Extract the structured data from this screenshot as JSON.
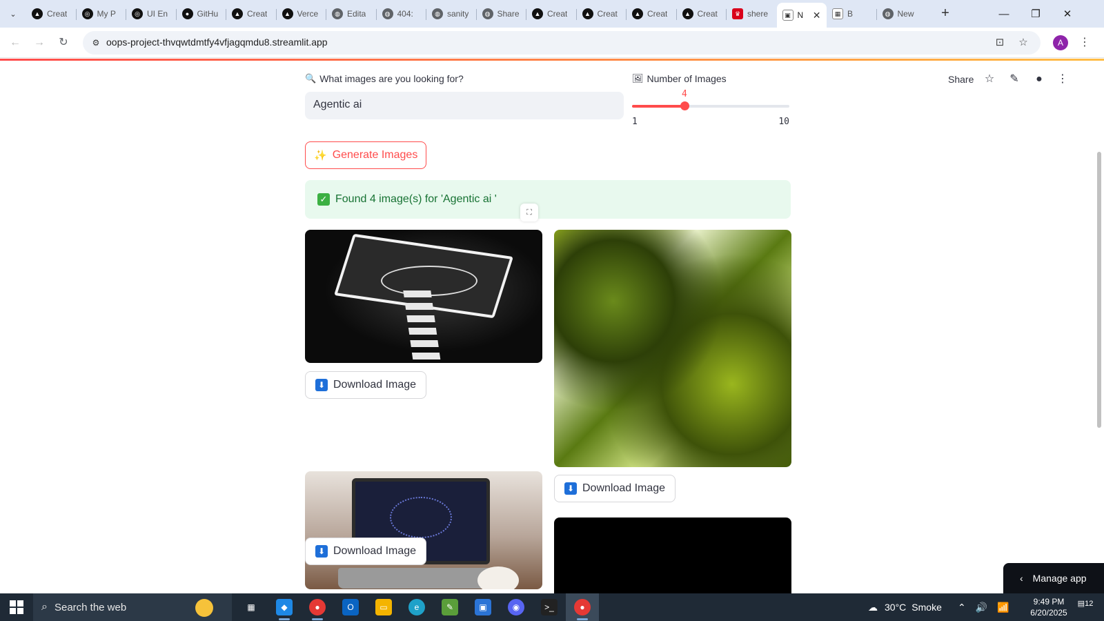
{
  "browser": {
    "tabs": [
      {
        "label": "Creat",
        "favicon": "triangle-logo"
      },
      {
        "label": "My P",
        "favicon": "openai-logo"
      },
      {
        "label": "UI En",
        "favicon": "openai-logo"
      },
      {
        "label": "GitHu",
        "favicon": "github-logo"
      },
      {
        "label": "Creat",
        "favicon": "triangle-logo"
      },
      {
        "label": "Verce",
        "favicon": "triangle-logo"
      },
      {
        "label": "Edita",
        "favicon": "globe"
      },
      {
        "label": "404:",
        "favicon": "globe"
      },
      {
        "label": "sanity",
        "favicon": "globe"
      },
      {
        "label": "Share",
        "favicon": "globe"
      },
      {
        "label": "Creat",
        "favicon": "triangle-logo"
      },
      {
        "label": "Creat",
        "favicon": "triangle-logo"
      },
      {
        "label": "Creat",
        "favicon": "triangle-logo"
      },
      {
        "label": "Creat",
        "favicon": "triangle-logo"
      },
      {
        "label": "shere",
        "favicon": "red-crown"
      },
      {
        "label": "N",
        "favicon": "streamlit-image",
        "active": true
      },
      {
        "label": "B",
        "favicon": "grid"
      },
      {
        "label": "New",
        "favicon": "globe"
      }
    ],
    "url": "oops-project-thvqwtdmtfy4vfjagqmdu8.streamlit.app",
    "profile_initial": "A"
  },
  "app": {
    "toolbar": {
      "share_label": "Share"
    },
    "search": {
      "label": "What images are you looking for?",
      "value": "Agentic ai"
    },
    "slider": {
      "label": "Number of Images",
      "value": "4",
      "min": "1",
      "max": "10",
      "fraction": 0.333
    },
    "generate_label": "Generate Images",
    "alert": "Found 4 image(s) for 'Agentic ai '",
    "download_label": "Download Image",
    "manage_label": "Manage app",
    "accent_color": "#ff4b4b"
  },
  "taskbar": {
    "search_placeholder": "Search the web",
    "weather": {
      "temp": "30°C",
      "condition": "Smoke"
    },
    "time": "9:49 PM",
    "date": "6/20/2025",
    "notifications": "12"
  }
}
